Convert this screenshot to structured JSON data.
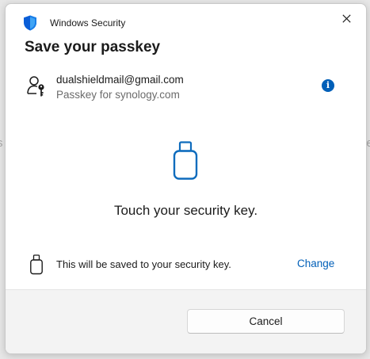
{
  "window": {
    "app_title": "Windows Security",
    "app_icon": "shield-icon",
    "close_icon": "close-icon"
  },
  "dialog": {
    "heading": "Save your passkey",
    "account": {
      "icon": "person-key-icon",
      "email": "dualshieldmail@gmail.com",
      "subtitle": "Passkey for synology.com",
      "info_icon_glyph": "i"
    },
    "prompt": {
      "icon": "usb-security-key-icon",
      "text": "Touch your security key."
    },
    "save_location": {
      "icon": "usb-key-small-icon",
      "text": "This will be saved to your security key.",
      "change_label": "Change"
    },
    "footer": {
      "cancel_label": "Cancel"
    }
  },
  "background": {
    "left_fragment": "s",
    "right_fragment": "he"
  },
  "colors": {
    "accent": "#005fb8",
    "footer_bg": "#f3f3f3",
    "dialog_bg": "#ffffff",
    "backdrop": "#e7e7e7"
  }
}
